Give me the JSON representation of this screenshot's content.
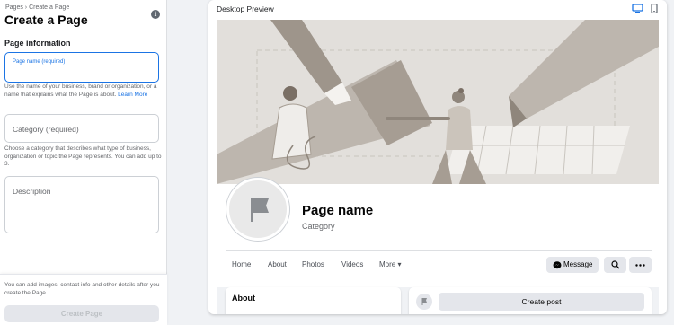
{
  "left": {
    "breadcrumb": "Pages › Create a Page",
    "title": "Create a Page",
    "info_icon": "info-icon",
    "section_title": "Page information",
    "page_name": {
      "label": "Page name (required)",
      "value": ""
    },
    "page_name_help": "Use the name of your business, brand or organization, or a name that explains what the Page is about.",
    "learn_more": "Learn More",
    "category": {
      "placeholder": "Category (required)"
    },
    "category_help": "Choose a category that describes what type of business, organization or topic the Page represents. You can add up to 3.",
    "description": {
      "placeholder": "Description"
    },
    "bottom_note": "You can add images, contact info and other details after you create the Page.",
    "create_button": "Create Page"
  },
  "preview": {
    "title": "Desktop Preview",
    "desktop_icon": "desktop-icon",
    "mobile_icon": "mobile-icon",
    "page_name": "Page name",
    "category": "Category",
    "tabs": [
      "Home",
      "About",
      "Photos",
      "Videos",
      "More ▾"
    ],
    "message_button": "Message",
    "search_icon": "search-icon",
    "more_icon": "more-icon",
    "about_title": "About",
    "create_post": "Create post",
    "accent": "#1b74e4"
  }
}
